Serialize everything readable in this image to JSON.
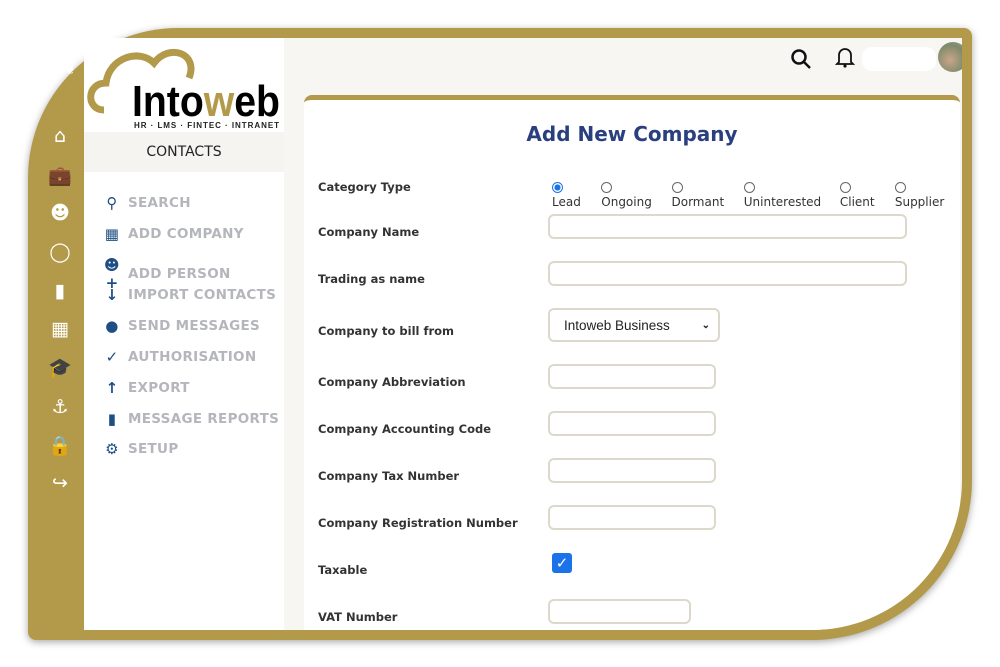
{
  "logo": {
    "brand": "Intoweb",
    "tagline": "HR · LMS · FINTEC · INTRANET"
  },
  "rail": [
    "leaf-icon",
    "home-icon",
    "briefcase-icon",
    "users-icon",
    "chat-icon",
    "folder-icon",
    "calendar-icon",
    "graduation-cap-icon",
    "anchor-icon",
    "lock-icon",
    "sign-out-icon"
  ],
  "menu": {
    "section": "CONTACTS",
    "items": [
      {
        "label": "SEARCH",
        "icon": "search-icon"
      },
      {
        "label": "ADD COMPANY",
        "icon": "building-icon"
      },
      {
        "label": "ADD PERSON",
        "icon": "user-plus-icon"
      },
      {
        "label": "IMPORT CONTACTS",
        "icon": "arrow-down-icon"
      },
      {
        "label": "SEND MESSAGES",
        "icon": "comment-icon"
      },
      {
        "label": "AUTHORISATION",
        "icon": "check-icon"
      },
      {
        "label": "EXPORT",
        "icon": "arrow-up-icon"
      },
      {
        "label": "MESSAGE REPORTS",
        "icon": "file-icon"
      },
      {
        "label": "SETUP",
        "icon": "gear-icon"
      }
    ]
  },
  "form": {
    "title": "Add New Company",
    "category": {
      "label": "Category Type",
      "options": [
        "Lead",
        "Ongoing",
        "Dormant",
        "Uninterested",
        "Client",
        "Supplier"
      ],
      "selected": "Lead"
    },
    "company_name": {
      "label": "Company Name",
      "value": ""
    },
    "trading_name": {
      "label": "Trading as name",
      "value": ""
    },
    "bill_from": {
      "label": "Company to bill from",
      "value": "Intoweb Business"
    },
    "abbreviation": {
      "label": "Company Abbreviation",
      "value": ""
    },
    "accounting_code": {
      "label": "Company Accounting Code",
      "value": ""
    },
    "tax_number": {
      "label": "Company Tax Number",
      "value": ""
    },
    "registration_number": {
      "label": "Company Registration Number",
      "value": ""
    },
    "taxable": {
      "label": "Taxable",
      "checked": true
    },
    "vat_number": {
      "label": "VAT Number",
      "value": ""
    }
  },
  "colors": {
    "gold": "#b39a4a",
    "navy": "#2a3f7e",
    "menu_icon": "#1f4e85"
  }
}
